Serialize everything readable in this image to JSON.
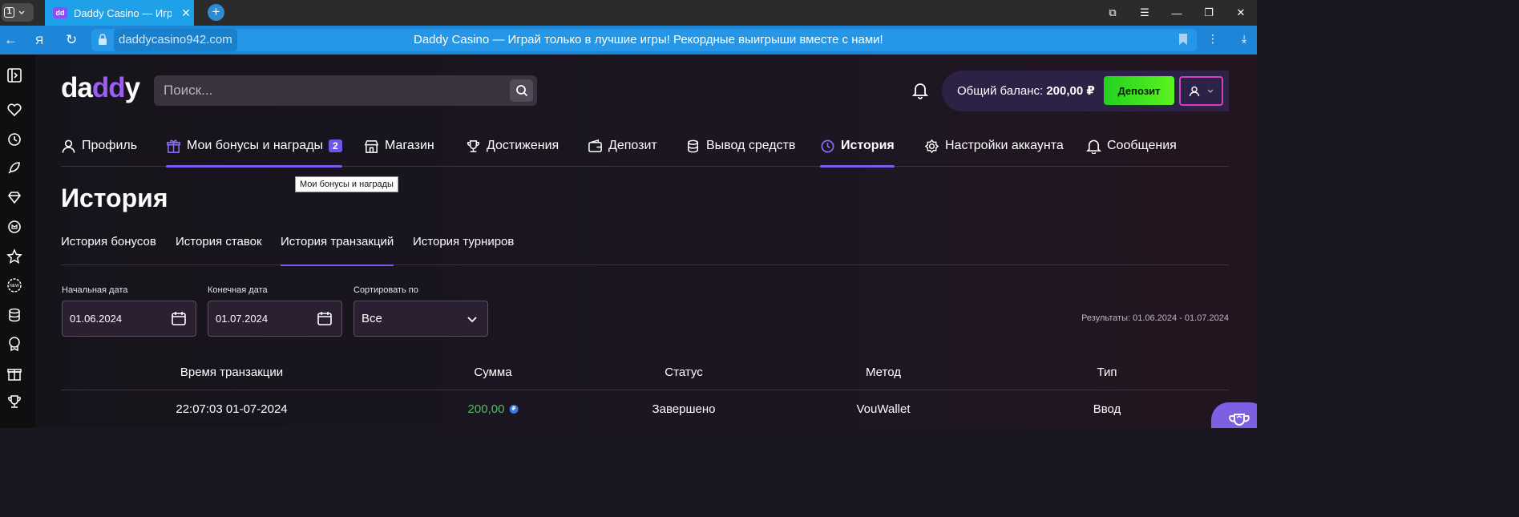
{
  "browser": {
    "tab_counter": "1",
    "tab_title": "Daddy Casino — Играй",
    "tab_favicon": "dd",
    "url_domain": "daddycasino942.com",
    "page_title": "Daddy Casino — Играй только в лучшие игры! Рекордные выигрыши вместе с нами!"
  },
  "site": {
    "logo_prefix": "da",
    "logo_accent": "dd",
    "logo_suffix": "y",
    "search_placeholder": "Поиск...",
    "balance_label": "Общий баланс:",
    "balance_value": "200,00 ₽",
    "deposit_button": "Депозит",
    "nav": [
      {
        "label": "Профиль",
        "icon": "user-icon"
      },
      {
        "label": "Мои бонусы и награды",
        "icon": "gift-icon",
        "badge": "2"
      },
      {
        "label": "Магазин",
        "icon": "store-icon"
      },
      {
        "label": "Достижения",
        "icon": "trophy-icon"
      },
      {
        "label": "Депозит",
        "icon": "wallet-icon"
      },
      {
        "label": "Вывод средств",
        "icon": "coins-icon"
      },
      {
        "label": "История",
        "icon": "history-icon",
        "active": true
      },
      {
        "label": "Настройки аккаунта",
        "icon": "settings-icon"
      },
      {
        "label": "Сообщения",
        "icon": "bell-icon"
      }
    ],
    "tooltip": "Мои бонусы и награды",
    "page_title": "История",
    "subtabs": [
      {
        "label": "История бонусов"
      },
      {
        "label": "История ставок"
      },
      {
        "label": "История транзакций",
        "active": true
      },
      {
        "label": "История турниров"
      }
    ],
    "filters": {
      "start_label": "Начальная дата",
      "start_value": "01.06.2024",
      "end_label": "Конечная дата",
      "end_value": "01.07.2024",
      "sort_label": "Сортировать по",
      "sort_value": "Все",
      "results": "Результаты: 01.06.2024 - 01.07.2024"
    },
    "table": {
      "headers": [
        "Время транзакции",
        "Сумма",
        "Статус",
        "Метод",
        "Тип"
      ],
      "rows": [
        {
          "time": "22:07:03 01-07-2024",
          "amount": "200,00",
          "currency_symbol": "₽",
          "status": "Завершено",
          "method": "VouWallet",
          "type": "Ввод"
        }
      ]
    },
    "colors": {
      "accent": "#7b5cf0",
      "deposit": "#3ee01f",
      "amount": "#4fbf6a",
      "user_border": "#d43ec0"
    }
  }
}
